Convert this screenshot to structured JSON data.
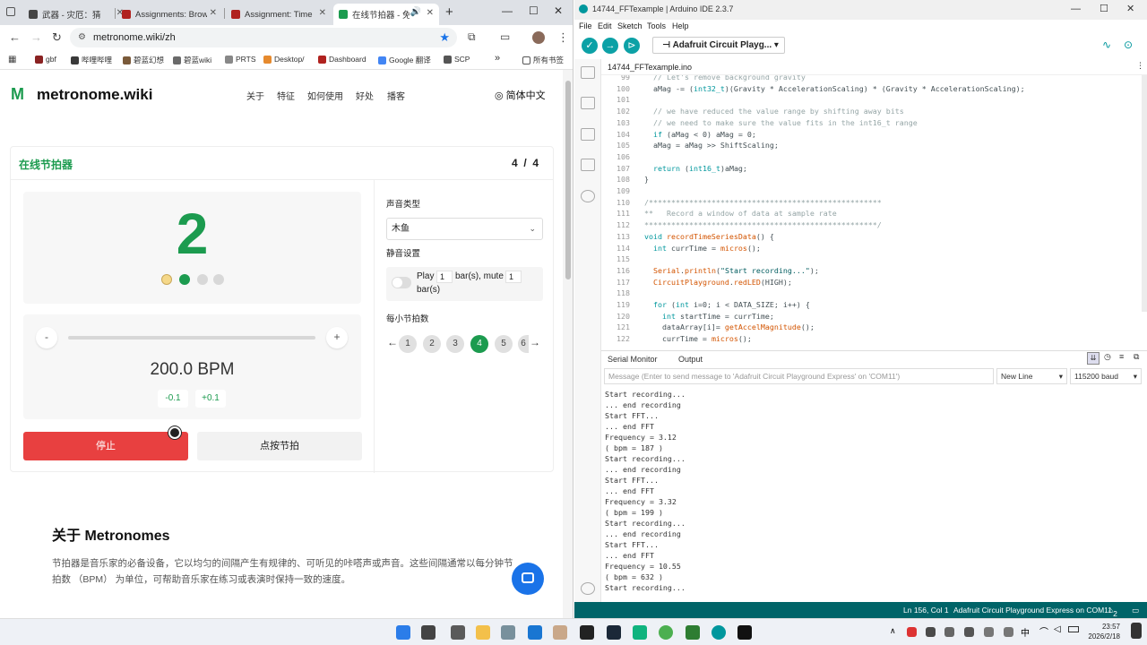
{
  "browser": {
    "tabs": [
      {
        "label": "武器 - 灾厄：猜",
        "color": "#444"
      },
      {
        "label": "Assignments: Brow",
        "color": "#b0221f"
      },
      {
        "label": "Assignment: Time",
        "color": "#b0221f"
      },
      {
        "label": "在线节拍器 - 免",
        "color": "#1c9b4f"
      }
    ],
    "new_tab": "+",
    "url": "metronome.wiki/zh",
    "bookmarks": [
      {
        "label": "gbf",
        "color": "#8a2222"
      },
      {
        "label": "哔哩哔哩",
        "color": "#3a3a3a"
      },
      {
        "label": "碧蓝幻想",
        "color": "#7a5a3a"
      },
      {
        "label": "碧蓝wiki",
        "color": "#6a6a6a"
      },
      {
        "label": "PRTS",
        "color": "#888"
      },
      {
        "label": "Desktop/",
        "color": "#e68a2e"
      },
      {
        "label": "Dashboard",
        "color": "#b0221f"
      },
      {
        "label": "Google 翻译",
        "color": "#4285f4"
      },
      {
        "label": "SCP",
        "color": "#555"
      }
    ],
    "bookmarks_more": "»",
    "all_bookmarks": "所有书签"
  },
  "site": {
    "logo": "metronome.wiki",
    "nav": [
      "关于",
      "特征",
      "如何使用",
      "好处",
      "播客"
    ],
    "lang": "简体中文",
    "card_title": "在线节拍器",
    "time_sig": "4  /  4",
    "beat": "2",
    "beats_dots": 4,
    "current_beat": 2,
    "minus": "-",
    "plus": "+",
    "bpm": "200.0 BPM",
    "fine_minus": "-0.1",
    "fine_plus": "+0.1",
    "stop": "停止",
    "tap": "点按节拍",
    "sound_label": "声音类型",
    "sound_value": "木鱼",
    "mute_label": "静音设置",
    "mute_play": "Play",
    "mute_play_val": "1",
    "mute_mid": "bar(s), mute",
    "mute_mute_val": "1",
    "mute_end": "bar(s)",
    "beats_label": "每小节拍数",
    "beats_options": [
      "1",
      "2",
      "3",
      "4",
      "5",
      "6"
    ],
    "beats_selected": "4",
    "about_title": "关于 Metronomes",
    "about_text": "节拍器是音乐家的必备设备，它以均匀的间隔产生有规律的、可听见的咔嗒声或声音。这些间隔通常以每分钟节拍数 （BPM） 为单位，可帮助音乐家在练习或表演时保持一致的速度。"
  },
  "ide": {
    "title": "14744_FFTexample | Arduino IDE 2.3.7",
    "menu": [
      "File",
      "Edit",
      "Sketch",
      "Tools",
      "Help"
    ],
    "board": "Adafruit Circuit Playg...",
    "file_tab": "14744_FFTexample.ino",
    "code": [
      {
        "n": "99",
        "t": "  // Let's remove background gravity"
      },
      {
        "n": "100",
        "t": "  aMag -= (int32_t)(Gravity * AccelerationScaling) * (Gravity * AccelerationScaling);"
      },
      {
        "n": "101",
        "t": ""
      },
      {
        "n": "102",
        "t": "  // we have reduced the value range by shifting away bits"
      },
      {
        "n": "103",
        "t": "  // we need to make sure the value fits in the int16_t range"
      },
      {
        "n": "104",
        "t": "  if (aMag < 0) aMag = 0;"
      },
      {
        "n": "105",
        "t": "  aMag = aMag >> ShiftScaling;"
      },
      {
        "n": "106",
        "t": ""
      },
      {
        "n": "107",
        "t": "  return (int16_t)aMag;"
      },
      {
        "n": "108",
        "t": "}"
      },
      {
        "n": "109",
        "t": ""
      },
      {
        "n": "110",
        "t": "/****************************************************"
      },
      {
        "n": "111",
        "t": "**   Record a window of data at sample rate"
      },
      {
        "n": "112",
        "t": "****************************************************/"
      },
      {
        "n": "113",
        "t": "void recordTimeSeriesData() {"
      },
      {
        "n": "114",
        "t": "  int currTime = micros();"
      },
      {
        "n": "115",
        "t": ""
      },
      {
        "n": "116",
        "t": "  Serial.println(\"Start recording...\");"
      },
      {
        "n": "117",
        "t": "  CircuitPlayground.redLED(HIGH);"
      },
      {
        "n": "118",
        "t": ""
      },
      {
        "n": "119",
        "t": "  for (int i=0; i < DATA_SIZE; i++) {"
      },
      {
        "n": "120",
        "t": "    int startTime = currTime;"
      },
      {
        "n": "121",
        "t": "    dataArray[i]= getAccelMagnitude();"
      },
      {
        "n": "122",
        "t": "    currTime = micros();"
      }
    ],
    "serial_tab": "Serial Monitor",
    "output_tab": "Output",
    "serial_placeholder": "Message (Enter to send message to 'Adafruit Circuit Playground Express' on 'COM11')",
    "line_ending": "New Line",
    "baud": "115200 baud",
    "serial_lines": [
      "Start recording...",
      "... end recording",
      "Start FFT...",
      "... end FFT",
      "Frequency = 3.12",
      "( bpm = 187 )",
      "Start recording...",
      "... end recording",
      "Start FFT...",
      "... end FFT",
      "Frequency = 3.32",
      "( bpm = 199 )",
      "Start recording...",
      "... end recording",
      "Start FFT...",
      "... end FFT",
      "Frequency = 10.55",
      "( bpm = 632 )",
      "Start recording..."
    ],
    "status_pos": "Ln 156, Col 1",
    "status_board": "Adafruit Circuit Playground Express on COM11",
    "status_notes": "2"
  },
  "taskbar": {
    "time": "23:57",
    "date": "2026/2/18",
    "ime": "中"
  }
}
